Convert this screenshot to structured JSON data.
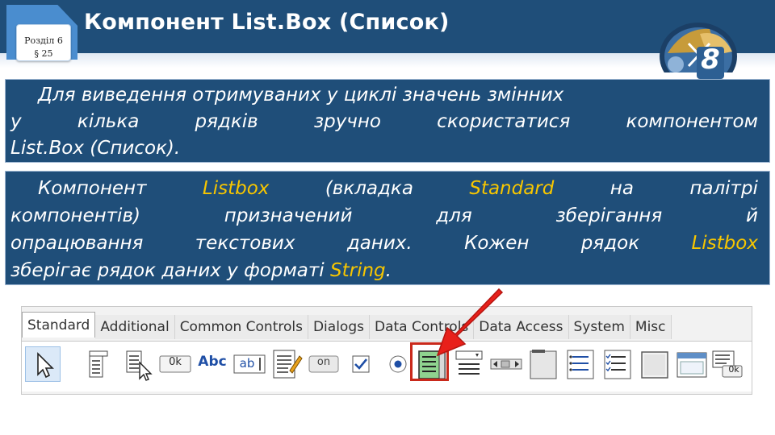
{
  "header": {
    "section_line1": "Розділ 6",
    "section_line2": "§ 25",
    "title": "Компонент List.Box (Список)",
    "grade_badge": "8"
  },
  "panel1": {
    "lines": [
      [
        "Для виведення отримуваних у циклі значень змінних"
      ],
      [
        "у",
        "кілька",
        "рядків",
        "зручно",
        "скористатися",
        "компонентом"
      ],
      [
        "List.Box (Список)."
      ]
    ]
  },
  "panel2": {
    "line1": [
      "Компонент",
      "Listbox",
      "(вкладка",
      "Standard",
      "на",
      "палітрі"
    ],
    "line2": [
      "компонентів)",
      "призначений",
      "для",
      "зберігання",
      "й"
    ],
    "line3": [
      "опрацювання",
      "текстових",
      "даних.",
      "Кожен",
      "рядок",
      "Listbox"
    ],
    "line4_before": "зберігає рядок даних у форматі ",
    "line4_kw": "String",
    "line4_after": "."
  },
  "palette": {
    "tabs": [
      "Standard",
      "Additional",
      "Common Controls",
      "Dialogs",
      "Data Controls",
      "Data Access",
      "System",
      "Misc"
    ],
    "active_tab": "Standard",
    "icon_labels": {
      "button": "0k",
      "label": "Abc",
      "edit": "ab",
      "toggle": "on",
      "bitbtn": "0k"
    },
    "icons": [
      "pointer-arrow",
      "main-menu",
      "popup-menu",
      "button",
      "label",
      "edit",
      "memo",
      "toggle-box",
      "check-box",
      "radio-button",
      "list-box",
      "combo-box",
      "scroll-bar",
      "group-box",
      "radio-group",
      "check-group",
      "panel",
      "frame",
      "action-list"
    ],
    "highlighted_icon": "list-box"
  },
  "colors": {
    "band": "#1f4e79",
    "keyword": "#f7c600",
    "highlight": "#c9291b",
    "arrow": "#e8201a"
  }
}
